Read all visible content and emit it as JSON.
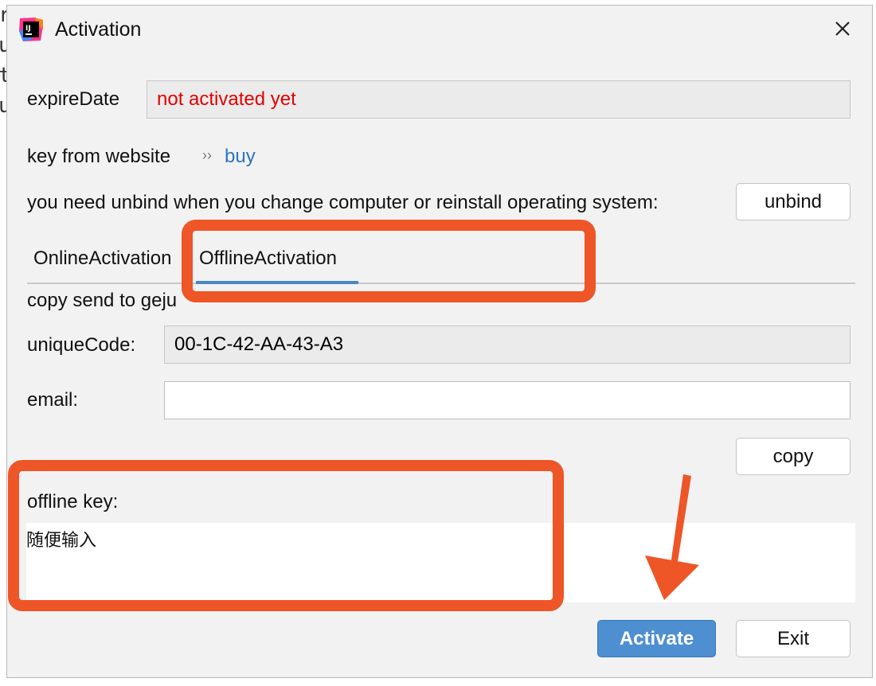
{
  "window": {
    "title": "Activation",
    "icon": "intellij-logo-icon",
    "close_icon": "close-icon"
  },
  "expire": {
    "label": "expireDate",
    "value": "not activated yet",
    "value_color": "#e30000"
  },
  "website": {
    "label": "key from website",
    "chevron": "››",
    "link": "buy"
  },
  "unbind": {
    "label": "you need unbind when you change computer or reinstall operating system:",
    "button": "unbind"
  },
  "tabs": [
    {
      "label": "OnlineActivation",
      "active": false
    },
    {
      "label": "OfflineActivation",
      "active": true
    }
  ],
  "offline": {
    "copy_send_text": "copy send to geju",
    "unique_label": "uniqueCode:",
    "unique_value": "00-1C-42-AA-43-A3",
    "email_label": "email:",
    "email_value": "",
    "copy_button": "copy",
    "key_label": "offline key:",
    "key_value": "随便输入"
  },
  "footer": {
    "activate_button": "Activate",
    "exit_button": "Exit"
  },
  "colors": {
    "annotation": "#ee5527",
    "link": "#2c74c4",
    "primary": "#4d8fd1",
    "tab_underline": "#4a86c8"
  },
  "background_code": [
    "r",
    "u",
    "t",
    "u"
  ]
}
